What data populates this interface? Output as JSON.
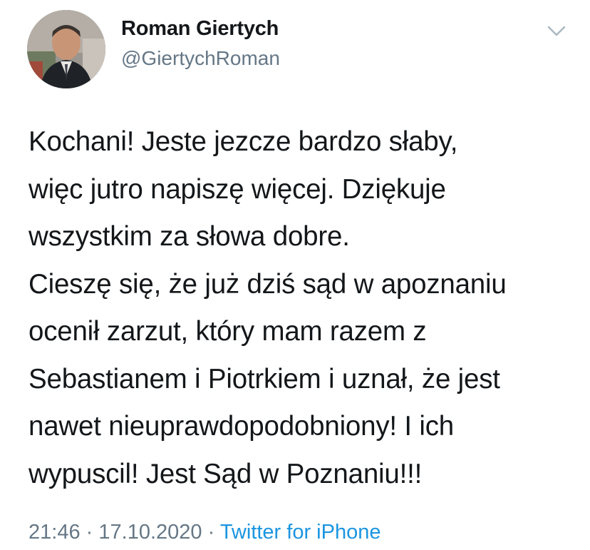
{
  "author": {
    "name": "Roman Giertych",
    "handle": "@GiertychRoman"
  },
  "tweet": {
    "lines": [
      "Kochani! Jeste jezcze bardzo słaby,",
      "więc jutro napiszę więcej. Dziękuje",
      "wszystkim za słowa dobre.",
      "Cieszę się, że już dziś sąd w apoznaniu",
      "ocenił zarzut, który mam razem z",
      "Sebastianem i Piotrkiem i uznał, że jest",
      "nawet nieuprawdopodobniony! I ich",
      "wypuscil! Jest Sąd w Poznaniu!!!"
    ]
  },
  "meta": {
    "time": "21:46",
    "separator": "·",
    "date": "17.10.2020",
    "source": "Twitter for iPhone"
  },
  "icons": {
    "menu": "chevron-down-icon",
    "avatar": "profile-photo"
  },
  "colors": {
    "text": "#14171a",
    "secondary": "#657786",
    "link": "#1b95e0",
    "chevron": "#aab8c2"
  }
}
